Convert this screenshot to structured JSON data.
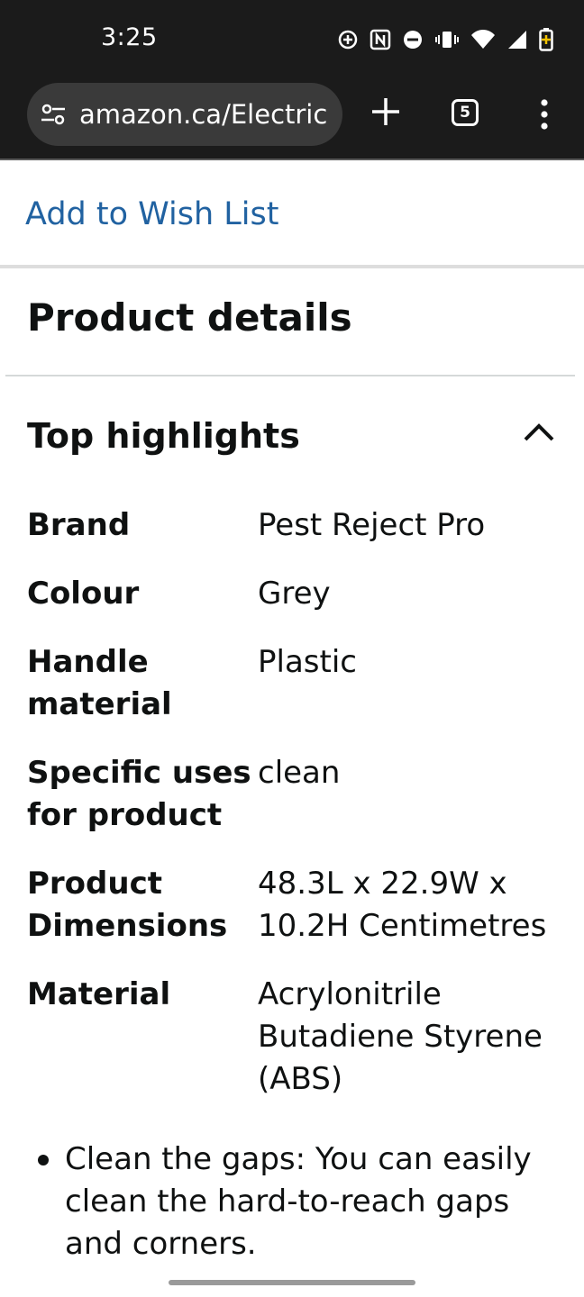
{
  "status_bar": {
    "time": "3:25",
    "icons": [
      "add-circle-icon",
      "nfc-icon",
      "do-not-disturb-icon",
      "vibrate-icon",
      "wifi-icon",
      "signal-icon",
      "battery-charging-icon"
    ]
  },
  "browser": {
    "url": "amazon.ca/Electric",
    "tab_count": "5",
    "icons": [
      "site-settings-icon",
      "new-tab-plus-icon",
      "tab-switcher-icon",
      "overflow-menu-icon"
    ]
  },
  "page": {
    "wish_list_label": "Add to Wish List",
    "product_details_heading": "Product details",
    "top_highlights_heading": "Top highlights",
    "specs": [
      {
        "label": "Brand",
        "value": "Pest Reject Pro"
      },
      {
        "label": "Colour",
        "value": "Grey"
      },
      {
        "label": "Handle material",
        "value": "Plastic"
      },
      {
        "label": "Specific uses for product",
        "value": "clean"
      },
      {
        "label": "Product Dimensions",
        "value": "48.3L x 22.9W x 10.2H Centimetres"
      },
      {
        "label": "Material",
        "value": "Acrylonitrile Butadiene Styrene (ABS)"
      }
    ],
    "bullets": [
      "Clean the gaps: You can easily clean the hard-to-reach gaps and corners."
    ]
  },
  "colors": {
    "link": "#2162a1",
    "text": "#0f1111",
    "chrome_bg": "#1b1b1b"
  }
}
